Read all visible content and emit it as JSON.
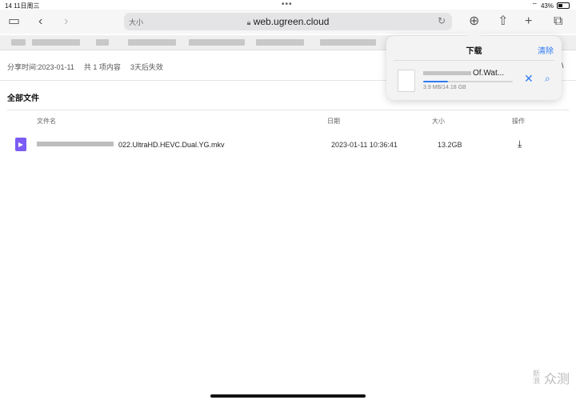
{
  "status_bar": {
    "time": "14",
    "date": "11日周三",
    "battery": "43%",
    "battery_level": 0.43
  },
  "address_bar": {
    "text_size": "大小",
    "url": "web.ugreen.cloud"
  },
  "share_info": {
    "share_time": "分享时间:2023-01-11",
    "item_count": "共 1 项内容",
    "expiry": "3天后失效"
  },
  "section_title": "全部文件",
  "table": {
    "headers": {
      "name": "文件名",
      "date": "日期",
      "size": "大小",
      "action": "操作"
    },
    "rows": [
      {
        "name_visible": "022.UltraHD.HEVC.Dual.YG.mkv",
        "date": "2023-01-11 10:36:41",
        "size": "13.2GB"
      }
    ]
  },
  "downloads_popover": {
    "title": "下载",
    "clear": "清除",
    "item": {
      "name_visible": "Of.Wat...",
      "size": "3.9 MB/14.18 GB",
      "progress": 0.275
    }
  },
  "watermark": {
    "char1": "新",
    "char2": "浪",
    "text": "众测"
  },
  "colors": {
    "accent": "#2f7bf5",
    "file_icon": "#7b5cf5"
  }
}
